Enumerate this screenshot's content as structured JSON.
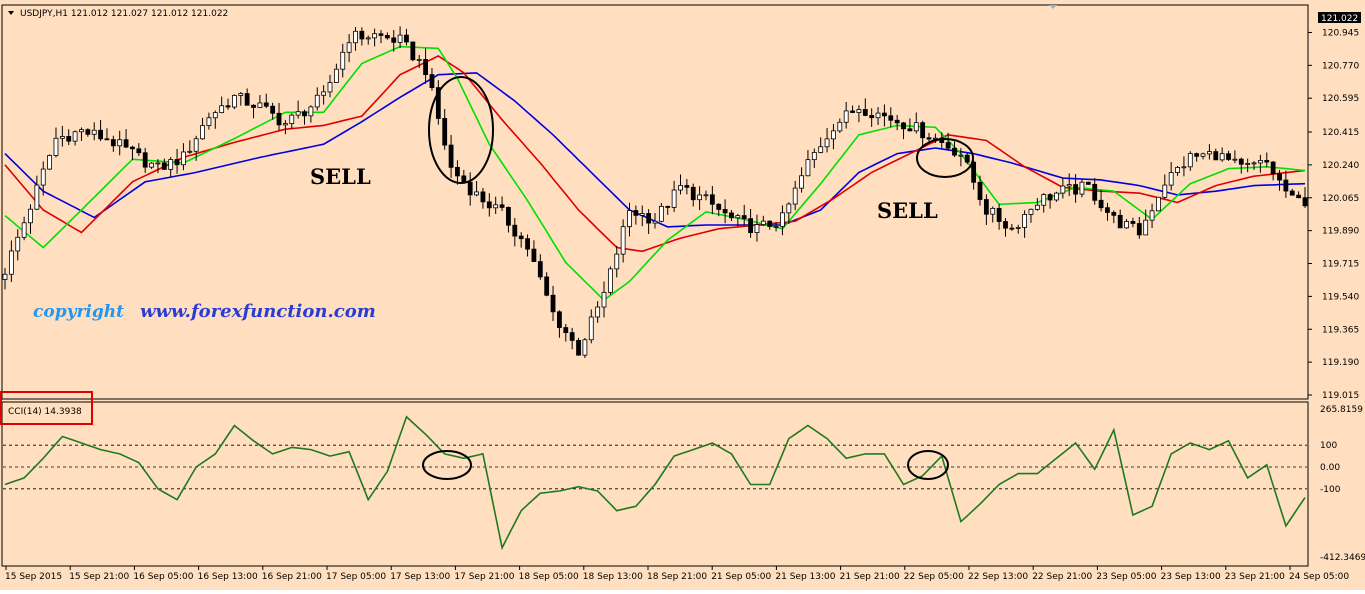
{
  "colors": {
    "background": "#ffdfbf",
    "candle": "#000000",
    "ma_fast": "#00e000",
    "ma_mid": "#e00000",
    "ma_slow": "#0000e0",
    "cci": "#1f7a1f",
    "highlight_box": "#e00000"
  },
  "chart_data": [
    {
      "type": "candlestick",
      "symbol_header": "USDJPY,H1  121.012 121.027 121.012 121.022",
      "current_price_label": "121.022",
      "ylim": [
        119.015,
        121.022
      ],
      "y_ticks": [
        "120.945",
        "120.770",
        "120.595",
        "120.415",
        "120.240",
        "120.065",
        "119.890",
        "119.715",
        "119.540",
        "119.365",
        "119.190",
        "119.015"
      ],
      "x_ticks": [
        "15 Sep 2015",
        "15 Sep 21:00",
        "16 Sep 05:00",
        "16 Sep 13:00",
        "16 Sep 21:00",
        "17 Sep 05:00",
        "17 Sep 13:00",
        "17 Sep 21:00",
        "18 Sep 05:00",
        "18 Sep 13:00",
        "18 Sep 21:00",
        "21 Sep 05:00",
        "21 Sep 13:00",
        "21 Sep 21:00",
        "22 Sep 05:00",
        "22 Sep 13:00",
        "22 Sep 21:00",
        "23 Sep 05:00",
        "23 Sep 13:00",
        "23 Sep 21:00",
        "24 Sep 05:00"
      ],
      "annotations": [
        {
          "text": "SELL",
          "at_bar": 50
        },
        {
          "text": "SELL",
          "at_bar": 144
        }
      ],
      "watermark": {
        "prefix": "copyright",
        "url": "www.forexfunction.com"
      },
      "close_anchor_bars": [
        0,
        4,
        8,
        12,
        16,
        20,
        24,
        28,
        32,
        36,
        40,
        44,
        50,
        54,
        58,
        62,
        66,
        70,
        74,
        78,
        82,
        86,
        90,
        94,
        98,
        102,
        106,
        110,
        114,
        118,
        122,
        126,
        130,
        134,
        138,
        142,
        146,
        150,
        154,
        158,
        162,
        166,
        170,
        174,
        178,
        182,
        186,
        190,
        194,
        198,
        202,
        204
      ],
      "close_anchor_values": [
        119.68,
        120.02,
        120.38,
        120.42,
        120.38,
        120.3,
        120.22,
        120.28,
        120.5,
        120.6,
        120.55,
        120.46,
        120.6,
        120.92,
        120.93,
        120.9,
        120.75,
        120.22,
        120.08,
        119.98,
        119.8,
        119.45,
        119.25,
        119.55,
        120.0,
        119.95,
        120.12,
        120.05,
        119.95,
        119.9,
        119.95,
        120.25,
        120.45,
        120.55,
        120.5,
        120.45,
        120.38,
        120.3,
        120.0,
        119.9,
        120.05,
        120.1,
        120.12,
        119.95,
        119.88,
        120.15,
        120.28,
        120.3,
        120.22,
        120.25,
        120.05,
        120.05
      ],
      "moving_averages": [
        {
          "role": "fast",
          "color": "#00e000",
          "anchor_bars": [
            0,
            6,
            12,
            20,
            28,
            36,
            44,
            50,
            56,
            62,
            68,
            71,
            76,
            82,
            88,
            94,
            98,
            104,
            110,
            116,
            122,
            128,
            134,
            140,
            146,
            150,
            156,
            162,
            168,
            174,
            180,
            186,
            192,
            198,
            204
          ],
          "anchor_values": [
            119.97,
            119.8,
            120.0,
            120.27,
            120.25,
            120.38,
            120.52,
            120.52,
            120.78,
            120.87,
            120.86,
            120.7,
            120.35,
            120.05,
            119.72,
            119.52,
            119.62,
            119.84,
            119.99,
            119.95,
            119.9,
            120.14,
            120.4,
            120.45,
            120.44,
            120.3,
            120.03,
            120.04,
            120.12,
            120.1,
            119.95,
            120.14,
            120.22,
            120.23,
            120.21
          ]
        },
        {
          "role": "mid",
          "color": "#e00000",
          "anchor_bars": [
            0,
            6,
            12,
            20,
            28,
            36,
            44,
            50,
            56,
            62,
            68,
            72,
            78,
            84,
            90,
            96,
            100,
            106,
            112,
            118,
            124,
            130,
            136,
            142,
            148,
            154,
            160,
            166,
            172,
            178,
            184,
            190,
            196,
            204
          ],
          "anchor_values": [
            120.24,
            120.0,
            119.88,
            120.15,
            120.28,
            120.36,
            120.43,
            120.45,
            120.5,
            120.72,
            120.82,
            120.73,
            120.48,
            120.25,
            120.0,
            119.8,
            119.78,
            119.85,
            119.9,
            119.92,
            119.94,
            120.06,
            120.2,
            120.3,
            120.4,
            120.37,
            120.23,
            120.12,
            120.1,
            120.09,
            120.04,
            120.13,
            120.18,
            120.21
          ]
        },
        {
          "role": "slow",
          "color": "#0000e0",
          "anchor_bars": [
            0,
            6,
            14,
            22,
            30,
            40,
            50,
            56,
            62,
            68,
            74,
            80,
            86,
            92,
            98,
            104,
            110,
            116,
            122,
            128,
            134,
            140,
            146,
            152,
            158,
            166,
            172,
            178,
            184,
            190,
            196,
            204
          ],
          "anchor_values": [
            120.3,
            120.1,
            119.96,
            120.15,
            120.2,
            120.28,
            120.35,
            120.47,
            120.6,
            120.72,
            120.73,
            120.58,
            120.4,
            120.2,
            120.0,
            119.91,
            119.92,
            119.92,
            119.92,
            120.0,
            120.2,
            120.3,
            120.33,
            120.3,
            120.25,
            120.17,
            120.16,
            120.13,
            120.08,
            120.1,
            120.13,
            120.14
          ]
        }
      ]
    },
    {
      "type": "line",
      "indicator_label": "CCI(14) 14.3938",
      "ylim": [
        -412.3469,
        265.8159
      ],
      "y_ticks": [
        "265.8159",
        "100",
        "0.00",
        "-100",
        "-412.3469"
      ],
      "levels": [
        100,
        0,
        -100
      ],
      "anchor_bars": [
        0,
        3,
        6,
        9,
        12,
        15,
        18,
        21,
        24,
        27,
        30,
        33,
        36,
        39,
        42,
        45,
        48,
        51,
        54,
        57,
        60,
        63,
        66,
        69,
        72,
        75,
        78,
        81,
        84,
        87,
        90,
        93,
        96,
        99,
        102,
        105,
        108,
        111,
        114,
        117,
        120,
        123,
        126,
        129,
        132,
        135,
        138,
        141,
        144,
        147,
        150,
        153,
        156,
        159,
        162,
        165,
        168,
        171,
        174,
        177,
        180,
        183,
        186,
        189,
        192,
        195,
        198,
        201,
        204
      ],
      "anchor_values": [
        -80,
        -50,
        40,
        140,
        110,
        80,
        60,
        20,
        -100,
        -150,
        0,
        60,
        190,
        120,
        60,
        90,
        80,
        50,
        70,
        -150,
        -20,
        230,
        150,
        60,
        40,
        60,
        -370,
        -200,
        -120,
        -110,
        -90,
        -110,
        -200,
        -180,
        -80,
        50,
        80,
        110,
        60,
        -80,
        -80,
        130,
        190,
        130,
        40,
        60,
        60,
        -80,
        -40,
        50,
        -250,
        -170,
        -80,
        -30,
        -30,
        40,
        110,
        -10,
        170,
        -220,
        -180,
        60,
        110,
        80,
        120,
        -50,
        10,
        -270,
        -140
      ]
    }
  ]
}
